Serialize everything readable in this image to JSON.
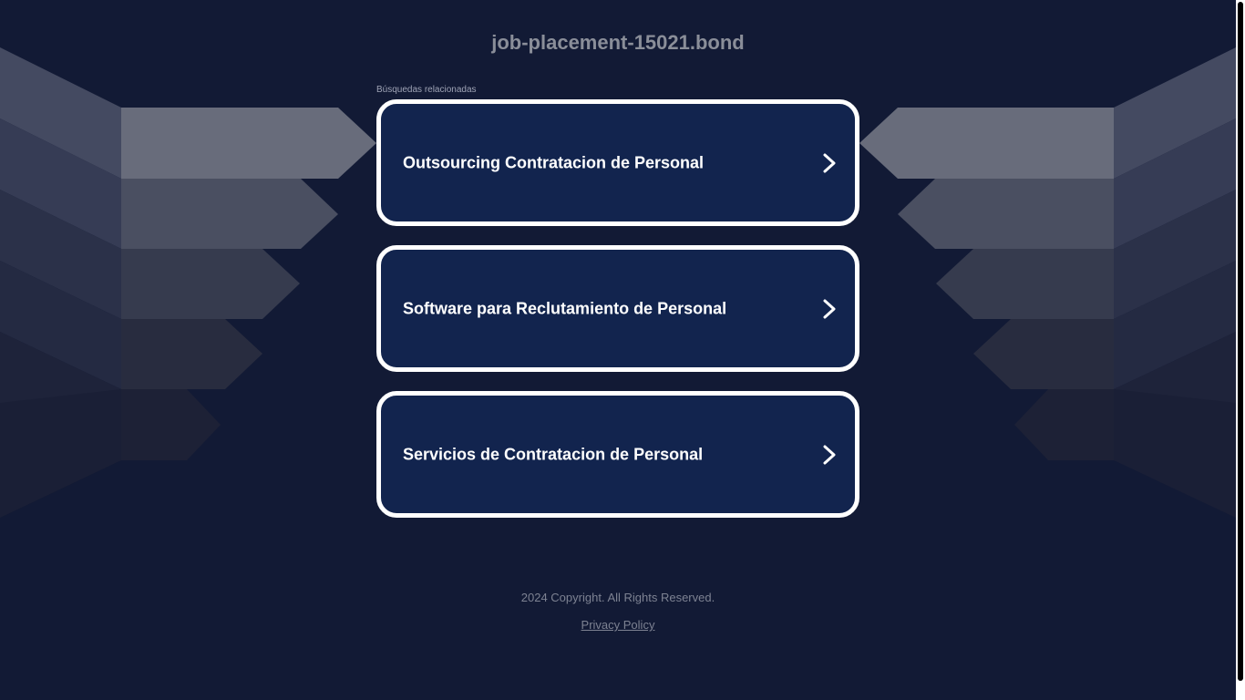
{
  "header": {
    "site_title": "job-placement-15021.bond"
  },
  "related": {
    "label": "Búsquedas relacionadas",
    "items": [
      {
        "label": "Outsourcing Contratacion de Personal"
      },
      {
        "label": "Software para Reclutamiento de Personal"
      },
      {
        "label": "Servicios de Contratacion de Personal"
      }
    ]
  },
  "footer": {
    "copyright": "2024 Copyright. All Rights Reserved.",
    "privacy_label": "Privacy Policy"
  },
  "icons": {
    "result_arrow": "chevron-right-icon"
  },
  "colors": {
    "background": "#121a35",
    "card_background": "#12244e",
    "card_border": "#ffffff",
    "title": "#8a8e99"
  }
}
